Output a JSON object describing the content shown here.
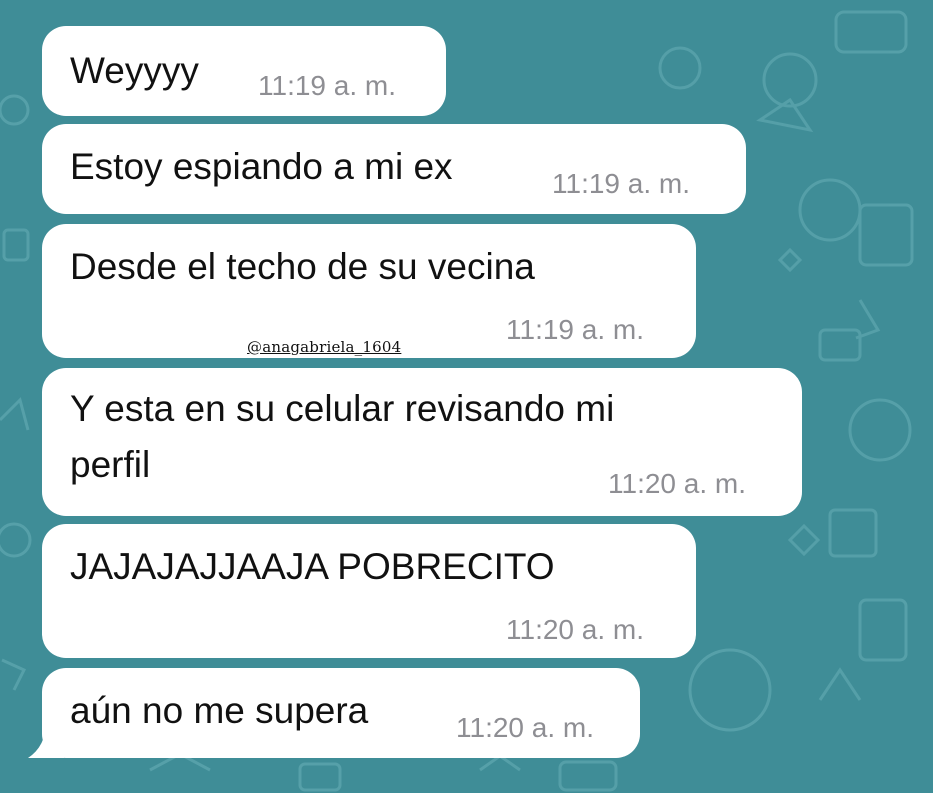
{
  "chat": {
    "background_color": "#3f8d97",
    "bubble_color": "#ffffff",
    "messages": [
      {
        "text": "Weyyyy",
        "time": "11:19 a. m."
      },
      {
        "text": "Estoy espiando a mi ex",
        "time": "11:19 a. m."
      },
      {
        "text": "Desde el techo de su vecina",
        "time": "11:19 a. m."
      },
      {
        "text": "Y esta en su celular revisando mi",
        "text_line2": "perfil",
        "time": "11:20 a. m."
      },
      {
        "text": "JAJAJAJJAAJA POBRECITO",
        "time": "11:20 a. m."
      },
      {
        "text": "aún no me supera",
        "time": "11:20 a. m."
      }
    ]
  },
  "watermark": {
    "text": "@anagabriela_1604"
  }
}
